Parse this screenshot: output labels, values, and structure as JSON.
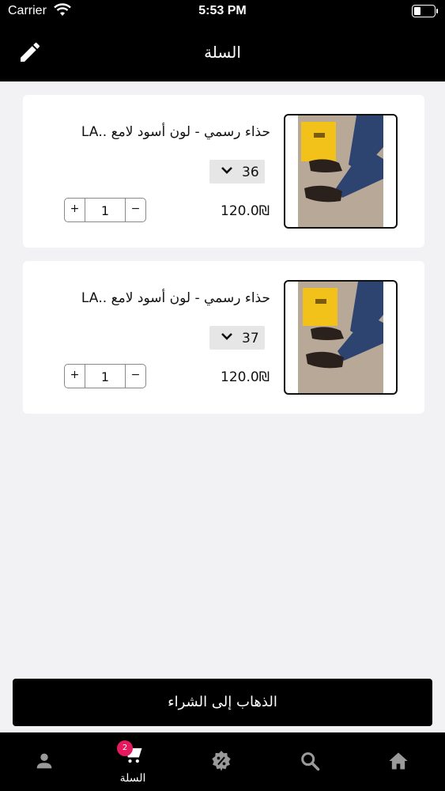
{
  "status_bar": {
    "carrier": "Carrier",
    "time": "5:53 PM"
  },
  "header": {
    "title": "السلة",
    "edit_icon": "pencil-icon"
  },
  "cart_items": [
    {
      "name": "حذاء رسمي - لون أسود لامع ..LA",
      "size": "36",
      "price": "120.0₪",
      "quantity": "1"
    },
    {
      "name": "حذاء رسمي - لون أسود لامع ..LA",
      "size": "37",
      "price": "120.0₪",
      "quantity": "1"
    }
  ],
  "stepper": {
    "plus": "+",
    "minus": "−"
  },
  "checkout": {
    "label": "الذهاب إلى الشراء"
  },
  "tabbar": {
    "items": [
      {
        "icon": "profile-icon",
        "label": ""
      },
      {
        "icon": "cart-icon",
        "label": "السلة",
        "badge": "2",
        "active": true
      },
      {
        "icon": "discount-icon",
        "label": ""
      },
      {
        "icon": "search-icon",
        "label": ""
      },
      {
        "icon": "home-icon",
        "label": ""
      }
    ]
  },
  "colors": {
    "header_bg": "#000000",
    "badge": "#e5195e",
    "background": "#f2f2f4"
  }
}
